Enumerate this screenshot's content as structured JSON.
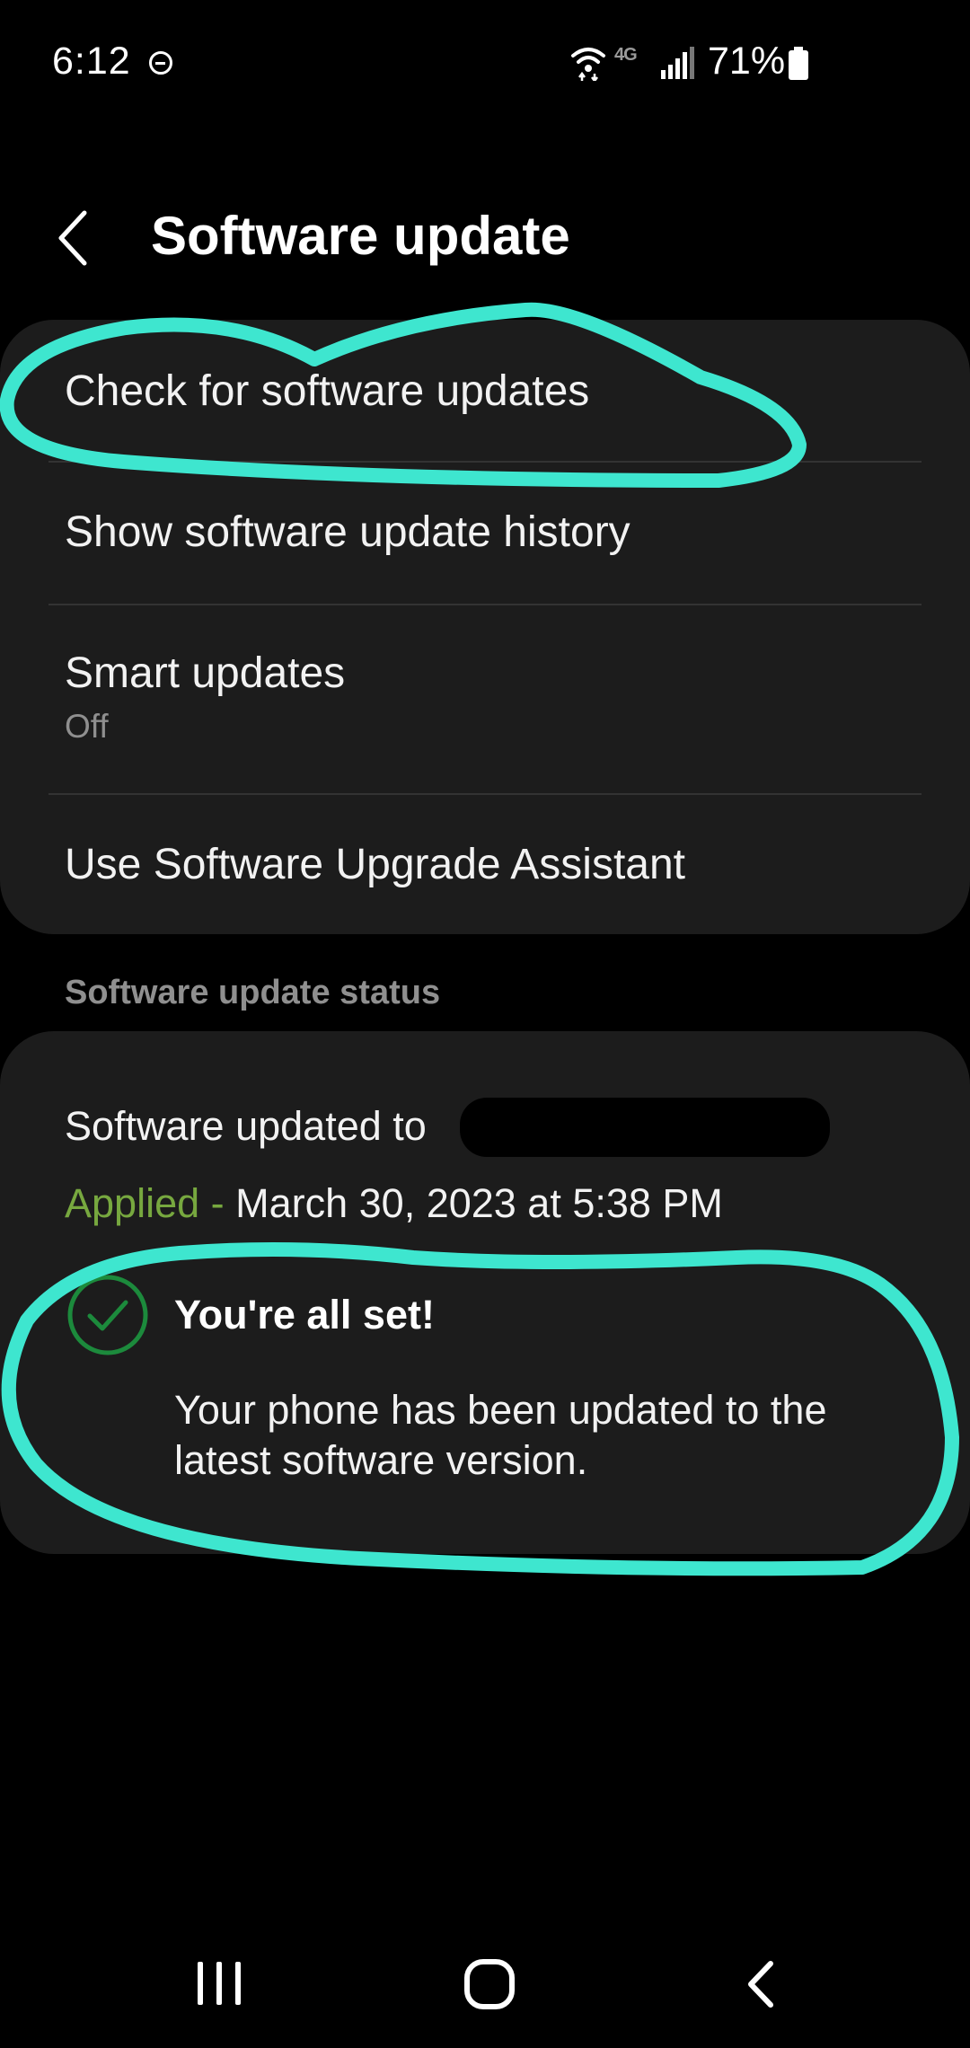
{
  "status_bar": {
    "time": "6:12",
    "dnd_icon": "do-not-disturb-icon",
    "wifi_icon": "wifi-icon",
    "network": "4G",
    "signal_icon": "signal-icon",
    "battery_percent": "71%",
    "battery_icon": "battery-icon"
  },
  "header": {
    "back_icon": "chevron-left-icon",
    "title": "Software update"
  },
  "menu": {
    "items": [
      {
        "label": "Check for software updates"
      },
      {
        "label": "Show software update history"
      },
      {
        "label": "Smart updates",
        "sublabel": "Off"
      },
      {
        "label": "Use Software Upgrade Assistant"
      }
    ]
  },
  "status_section": {
    "header": "Software update status",
    "updated_label": "Software updated to",
    "applied_word": "Applied - ",
    "applied_date": "March 30, 2023 at 5:38 PM",
    "check_icon": "check-circle-icon",
    "title": "You're all set!",
    "description": "Your phone has been updated to the latest software version."
  },
  "nav_bar": {
    "recents_icon": "recents-icon",
    "home_icon": "home-icon",
    "back_icon": "back-icon"
  },
  "colors": {
    "background": "#000000",
    "card": "#1c1c1c",
    "applied_green": "#77a83f",
    "check_green": "#1c8a3c",
    "annotation": "#3ee6cf"
  }
}
